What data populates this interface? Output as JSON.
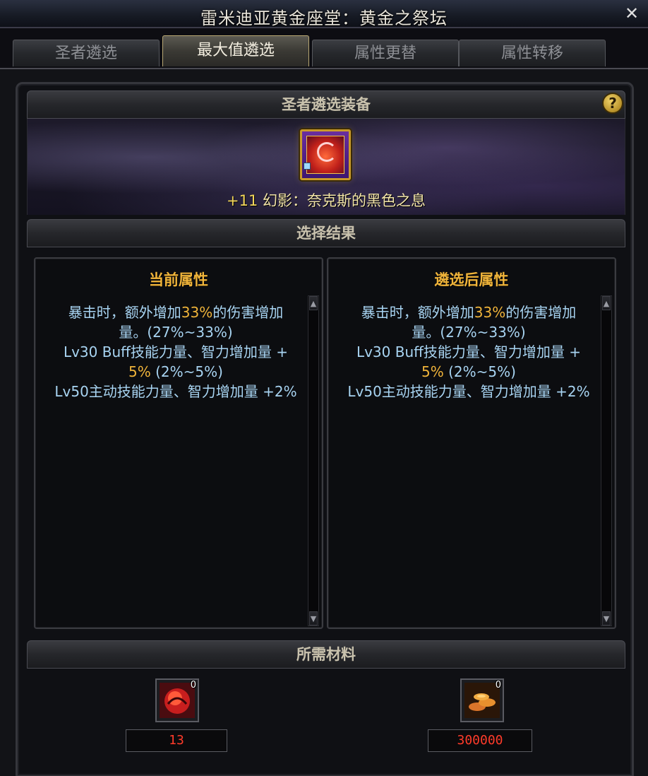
{
  "window": {
    "title": "雷米迪亚黄金座堂：黄金之祭坛",
    "close_glyph": "✕"
  },
  "tabs": [
    {
      "label": "圣者遴选",
      "active": false
    },
    {
      "label": "最大值遴选",
      "active": true
    },
    {
      "label": "属性更替",
      "active": false
    },
    {
      "label": "属性转移",
      "active": false
    }
  ],
  "equipment_section": {
    "header": "圣者遴选装备",
    "help_glyph": "?",
    "item": {
      "icon": "spirit-orb-icon",
      "plus": "+11",
      "name": "幻影：奈克斯的黑色之息"
    }
  },
  "result_section": {
    "header": "选择结果",
    "current": {
      "title": "当前属性",
      "lines": [
        {
          "pre": "暴击时，额外增加",
          "hl": "33%",
          "post": "的伤害增加"
        },
        {
          "pre": "量。(27%~33%)",
          "hl": "",
          "post": ""
        },
        {
          "pre": "Lv30 Buff技能力量、智力增加量 +",
          "hl": "",
          "post": ""
        },
        {
          "pre": "",
          "hl": "5%",
          "post": " (2%~5%)"
        },
        {
          "pre": "Lv50主动技能力量、智力增加量 +2%",
          "hl": "",
          "post": ""
        }
      ]
    },
    "after": {
      "title": "遴选后属性",
      "lines": [
        {
          "pre": "暴击时，额外增加",
          "hl": "33%",
          "post": "的伤害增加"
        },
        {
          "pre": "量。(27%~33%)",
          "hl": "",
          "post": ""
        },
        {
          "pre": "Lv30 Buff技能力量、智力增加量 +",
          "hl": "",
          "post": ""
        },
        {
          "pre": "",
          "hl": "5%",
          "post": " (2%~5%)"
        },
        {
          "pre": "Lv50主动技能力量、智力增加量 +2%",
          "hl": "",
          "post": ""
        }
      ]
    },
    "scroll_up": "▲",
    "scroll_down": "▼"
  },
  "materials_section": {
    "header": "所需材料",
    "items": [
      {
        "icon": "red-crystal-icon",
        "owned": "0",
        "required": "13"
      },
      {
        "icon": "gold-coins-icon",
        "owned": "0",
        "required": "300000"
      }
    ]
  }
}
